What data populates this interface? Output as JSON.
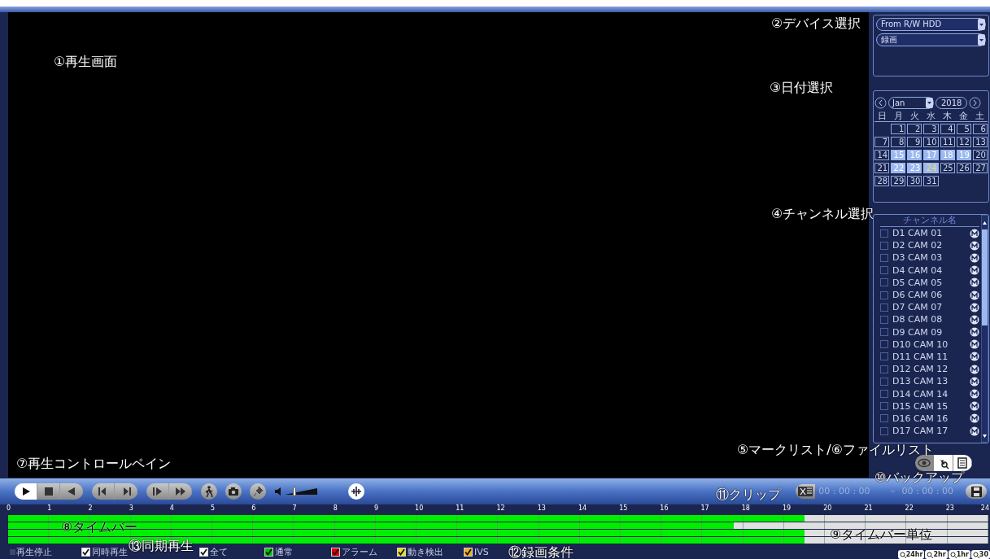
{
  "annotations": [
    "①再生画面",
    "②デバイス選択",
    "③日付選択",
    "④チャンネル選択",
    "⑤マークリスト/⑥ファイルリスト",
    "⑦再生コントロールペイン",
    "⑧タイムバー",
    "⑨タイムバー単位",
    "⑩バックアップ",
    "⑪クリップ",
    "⑫録画条件",
    "⑬同期再生"
  ],
  "device": {
    "source": "From R/W HDD",
    "type": "録画"
  },
  "calendar": {
    "month": "Jan",
    "year": "2018",
    "weekdays": [
      "日",
      "月",
      "火",
      "水",
      "木",
      "金",
      "土"
    ],
    "weeks": [
      [
        {
          "label": "1",
          "marked": false,
          "today": false
        },
        {
          "label": "2",
          "marked": false,
          "today": false
        },
        {
          "label": "3",
          "marked": false,
          "today": false
        },
        {
          "label": "4",
          "marked": false,
          "today": false
        },
        {
          "label": "5",
          "marked": false,
          "today": false
        },
        {
          "label": "6",
          "marked": false,
          "today": false
        }
      ],
      [
        {
          "label": "7",
          "marked": false,
          "today": false
        },
        {
          "label": "8",
          "marked": false,
          "today": false
        },
        {
          "label": "9",
          "marked": false,
          "today": false
        },
        {
          "label": "10",
          "marked": false,
          "today": false
        },
        {
          "label": "11",
          "marked": false,
          "today": false
        },
        {
          "label": "12",
          "marked": false,
          "today": false
        },
        {
          "label": "13",
          "marked": false,
          "today": false
        }
      ],
      [
        {
          "label": "14",
          "marked": false,
          "today": false
        },
        {
          "label": "15",
          "marked": true,
          "today": false
        },
        {
          "label": "16",
          "marked": true,
          "today": false
        },
        {
          "label": "17",
          "marked": true,
          "today": false
        },
        {
          "label": "18",
          "marked": true,
          "today": false
        },
        {
          "label": "19",
          "marked": true,
          "today": false
        },
        {
          "label": "20",
          "marked": false,
          "today": false
        }
      ],
      [
        {
          "label": "21",
          "marked": false,
          "today": false
        },
        {
          "label": "22",
          "marked": true,
          "today": false
        },
        {
          "label": "23",
          "marked": true,
          "today": false
        },
        {
          "label": "24",
          "marked": true,
          "today": true
        },
        {
          "label": "25",
          "marked": false,
          "today": false
        },
        {
          "label": "26",
          "marked": false,
          "today": false
        },
        {
          "label": "27",
          "marked": false,
          "today": false
        }
      ],
      [
        {
          "label": "28",
          "marked": false,
          "today": false
        },
        {
          "label": "29",
          "marked": false,
          "today": false
        },
        {
          "label": "30",
          "marked": false,
          "today": false
        },
        {
          "label": "31",
          "marked": false,
          "today": false
        }
      ]
    ]
  },
  "channels": {
    "header": "チャンネル名",
    "items": [
      {
        "label": "D1 CAM 01",
        "checked": false
      },
      {
        "label": "D2 CAM 02",
        "checked": false
      },
      {
        "label": "D3 CAM 03",
        "checked": false
      },
      {
        "label": "D4 CAM 04",
        "checked": false
      },
      {
        "label": "D5 CAM 05",
        "checked": false
      },
      {
        "label": "D6 CAM 06",
        "checked": false
      },
      {
        "label": "D7 CAM 07",
        "checked": false
      },
      {
        "label": "D8 CAM 08",
        "checked": false
      },
      {
        "label": "D9 CAM 09",
        "checked": false
      },
      {
        "label": "D10 CAM 10",
        "checked": false
      },
      {
        "label": "D11 CAM 11",
        "checked": false
      },
      {
        "label": "D12 CAM 12",
        "checked": false
      },
      {
        "label": "D13 CAM 13",
        "checked": false
      },
      {
        "label": "D14 CAM 14",
        "checked": false
      },
      {
        "label": "D15 CAM 15",
        "checked": false
      },
      {
        "label": "D16 CAM 16",
        "checked": false
      },
      {
        "label": "D17 CAM 17",
        "checked": false
      }
    ]
  },
  "list_buttons": [
    {
      "kind": "eye",
      "selected": true
    },
    {
      "kind": "search",
      "selected": false
    },
    {
      "kind": "list",
      "selected": false
    }
  ],
  "transport": [
    [
      {
        "kind": "play",
        "selected": true
      },
      {
        "kind": "stop",
        "selected": false
      },
      {
        "kind": "reverse",
        "selected": false
      }
    ],
    [
      {
        "kind": "slow_back",
        "selected": false
      },
      {
        "kind": "slow_forward",
        "selected": false
      }
    ],
    [
      {
        "kind": "step",
        "selected": false
      },
      {
        "kind": "fast",
        "selected": false
      }
    ]
  ],
  "tools": [
    {
      "kind": "person"
    },
    {
      "kind": "camera"
    },
    {
      "kind": "pin"
    }
  ],
  "volume": {
    "level": 0.3
  },
  "clip": {
    "start": "00 : 00 : 00",
    "separator": "－",
    "end": "00 : 00 : 00"
  },
  "timeline": {
    "hours": [
      "0",
      "1",
      "2",
      "3",
      "4",
      "5",
      "6",
      "7",
      "8",
      "9",
      "10",
      "11",
      "12",
      "13",
      "14",
      "15",
      "16",
      "17",
      "18",
      "19",
      "20",
      "21",
      "22",
      "23",
      "24"
    ],
    "tracks": [
      {
        "level": 0.8125
      },
      {
        "level": 0.74
      },
      {
        "level": 0.8125
      },
      {
        "level": 0.8125
      }
    ]
  },
  "legend": [
    {
      "kind": "indicator",
      "label": "再生停止"
    },
    {
      "kind": "checkbox",
      "label": "同時再生",
      "checked": true,
      "color": "#ffffff"
    },
    {
      "kind": "checkbox",
      "label": "全て",
      "checked": true,
      "color": "#ffffff"
    },
    {
      "kind": "checkbox",
      "label": "通常",
      "checked": true,
      "color": "#00c800"
    },
    {
      "kind": "checkbox",
      "label": "アラーム",
      "checked": true,
      "color": "#e00000"
    },
    {
      "kind": "checkbox",
      "label": "動き検出",
      "checked": true,
      "color": "#e8e020"
    },
    {
      "kind": "checkbox",
      "label": "IVS",
      "checked": true,
      "color": "#f0b020"
    }
  ],
  "zoom": [
    {
      "label": "24hr"
    },
    {
      "label": "2hr"
    },
    {
      "label": "1hr"
    },
    {
      "label": "30"
    }
  ]
}
